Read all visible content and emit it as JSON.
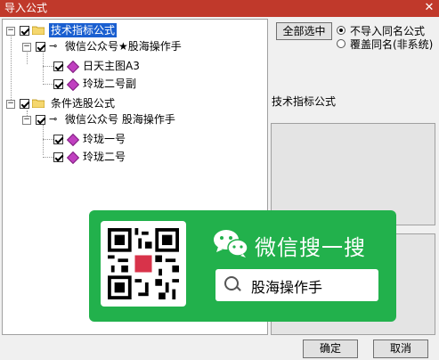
{
  "window": {
    "title": "导入公式",
    "close": "✕"
  },
  "tree": {
    "group1": {
      "label": "技术指标公式",
      "author": "微信公众号★股海操作手",
      "items": [
        "日天主图A3",
        "玲珑二号副"
      ]
    },
    "group2": {
      "label": "条件选股公式",
      "author": "微信公众号 股海操作手",
      "items": [
        "玲珑一号",
        "玲珑二号"
      ]
    }
  },
  "options": {
    "select_all": "全部选中",
    "radio1": "不导入同名公式",
    "radio2": "覆盖同名(非系统)",
    "selected": "radio1"
  },
  "info": {
    "type_label": "技术指标公式"
  },
  "overlay": {
    "title": "微信搜一搜",
    "search_text": "股海操作手",
    "accent": "#22b14c"
  },
  "footer": {
    "ok": "确定",
    "cancel": "取消"
  }
}
